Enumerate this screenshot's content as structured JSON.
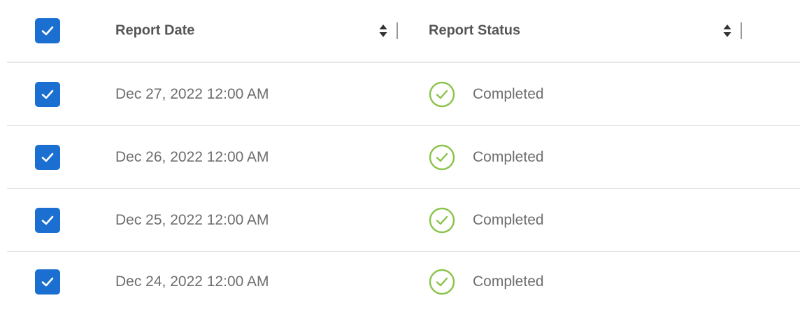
{
  "table": {
    "header": {
      "columns": [
        {
          "label": "Report Date"
        },
        {
          "label": "Report Status"
        }
      ],
      "select_all_checked": true
    },
    "rows": [
      {
        "date": "Dec 27, 2022 12:00 AM",
        "status": "Completed",
        "checked": true
      },
      {
        "date": "Dec 26, 2022 12:00 AM",
        "status": "Completed",
        "checked": true
      },
      {
        "date": "Dec 25, 2022 12:00 AM",
        "status": "Completed",
        "checked": true
      },
      {
        "date": "Dec 24, 2022 12:00 AM",
        "status": "Completed",
        "checked": true
      }
    ]
  },
  "colors": {
    "checkbox": "#1a6fd1",
    "status_completed": "#8bc34a",
    "text": "#6e6e6e",
    "header_text": "#555555"
  },
  "icons": {
    "checkbox": "checkmark-icon",
    "sort": "sort-arrows-icon",
    "status": "check-circle-icon"
  }
}
